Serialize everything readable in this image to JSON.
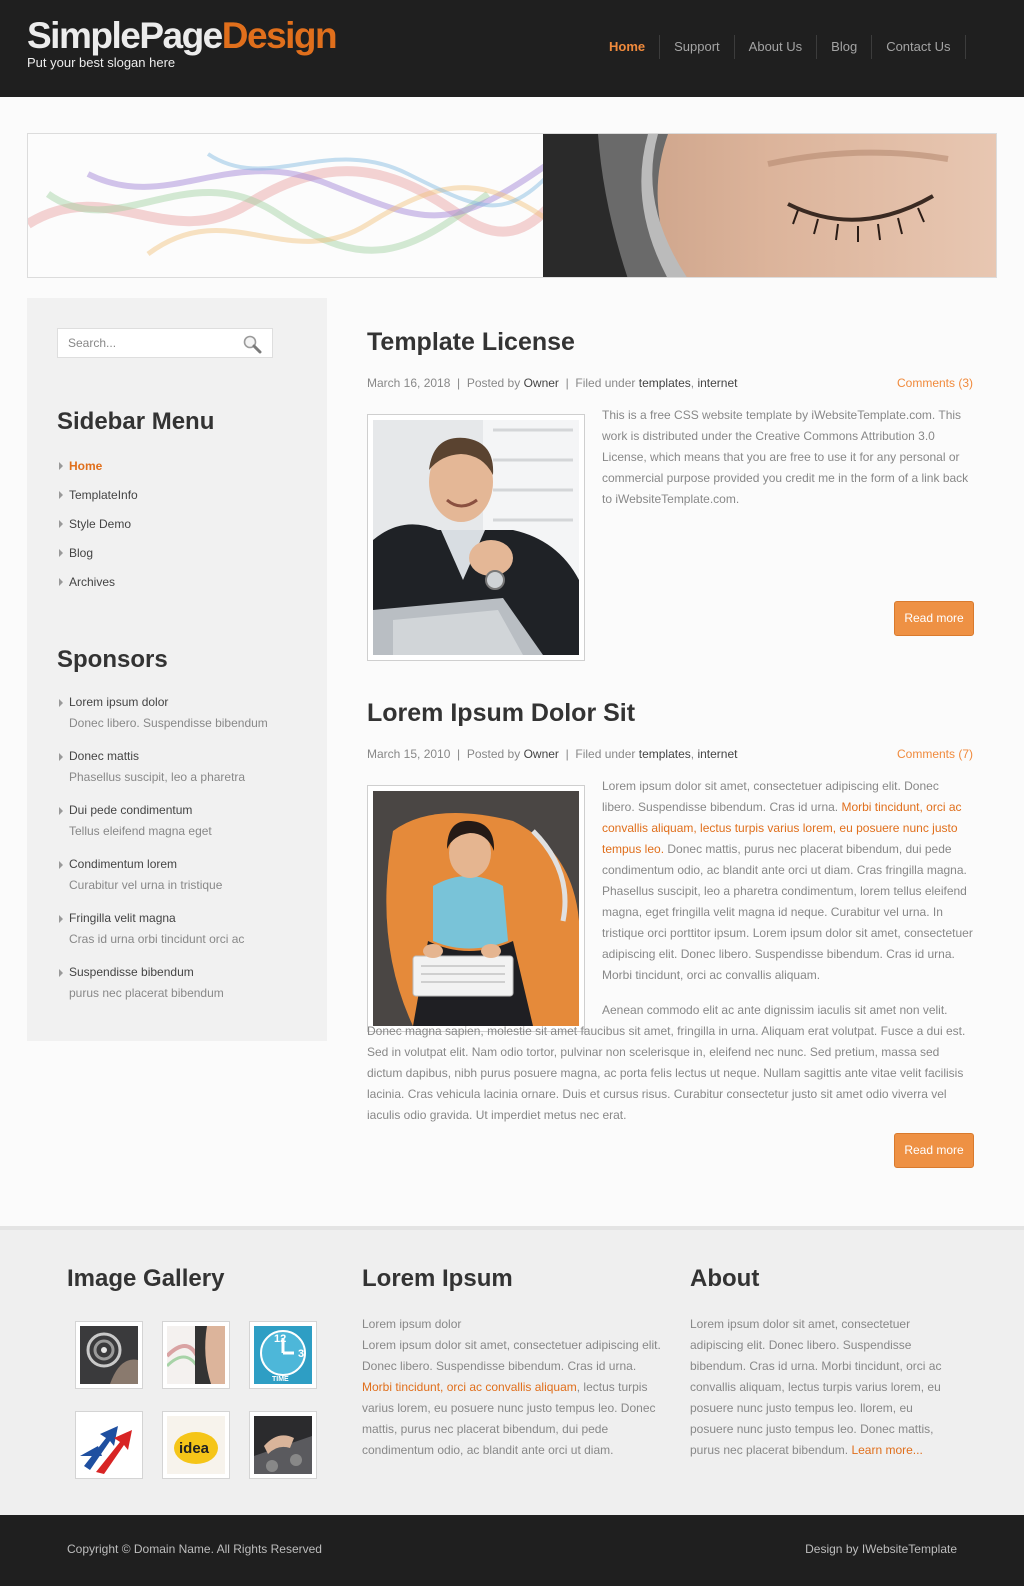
{
  "site": {
    "logo_part1": "SimplePage",
    "logo_part2": "Design",
    "slogan": "Put your best slogan here"
  },
  "nav": [
    "Home",
    "Support",
    "About Us",
    "Blog",
    "Contact Us"
  ],
  "search": {
    "placeholder": "Search..."
  },
  "sidebar": {
    "menu_title": "Sidebar Menu",
    "menu": [
      "Home",
      "TemplateInfo",
      "Style Demo",
      "Blog",
      "Archives"
    ],
    "sponsors_title": "Sponsors",
    "sponsors": [
      {
        "title": "Lorem ipsum dolor",
        "desc": "Donec libero. Suspendisse bibendum"
      },
      {
        "title": "Donec mattis",
        "desc": "Phasellus suscipit, leo a pharetra"
      },
      {
        "title": "Dui pede condimentum",
        "desc": "Tellus eleifend magna eget"
      },
      {
        "title": "Condimentum lorem",
        "desc": "Curabitur vel urna in tristique"
      },
      {
        "title": "Fringilla velit magna",
        "desc": "Cras id urna orbi tincidunt orci ac"
      },
      {
        "title": "Suspendisse bibendum",
        "desc": "purus nec placerat bibendum"
      }
    ]
  },
  "posts": [
    {
      "title": "Template License",
      "date": "March 16, 2018",
      "posted_by_label": "Posted by",
      "author": "Owner",
      "filed_label": "Filed under",
      "tag1": "templates",
      "tag2": "internet",
      "comments": "Comments (3)",
      "text": "This is a free CSS website template by iWebsiteTemplate.com. This work is distributed under the Creative Commons Attribution 3.0 License, which means that you are free to use it for any personal or commercial purpose provided you credit me in the form of a link back to iWebsiteTemplate.com.",
      "read_more": "Read more"
    },
    {
      "title": "Lorem Ipsum Dolor Sit",
      "date": "March 15, 2010",
      "posted_by_label": "Posted by",
      "author": "Owner",
      "filed_label": "Filed under",
      "tag1": "templates",
      "tag2": "internet",
      "comments": "Comments (7)",
      "text_before": "Lorem ipsum dolor sit amet, consectetuer adipiscing elit. Donec libero. Suspendisse bibendum. Cras id urna. ",
      "text_link": "Morbi tincidunt, orci ac convallis aliquam, lectus turpis varius lorem, eu posuere nunc justo tempus leo.",
      "text_after": " Donec mattis, purus nec placerat bibendum, dui pede condimentum odio, ac blandit ante orci ut diam. Cras fringilla magna. Phasellus suscipit, leo a pharetra condimentum, lorem tellus eleifend magna, eget fringilla velit magna id neque. Curabitur vel urna. In tristique orci porttitor ipsum. Lorem ipsum dolor sit amet, consectetuer adipiscing elit. Donec libero. Suspendisse bibendum. Cras id urna. Morbi tincidunt, orci ac convallis aliquam.",
      "text2": "Aenean commodo elit ac ante dignissim iaculis sit amet non velit. Donec magna sapien, molestie sit amet faucibus sit amet, fringilla in urna. Aliquam erat volutpat. Fusce a dui est. Sed in volutpat elit. Nam odio tortor, pulvinar non scelerisque in, eleifend nec nunc. Sed pretium, massa sed dictum dapibus, nibh purus posuere magna, ac porta felis lectus ut neque. Nullam sagittis ante vitae velit facilisis lacinia. Cras vehicula lacinia ornare. Duis et cursus risus. Curabitur consectetur justo sit amet odio viverra vel iaculis odio gravida. Ut imperdiet metus nec erat.",
      "read_more": "Read more"
    }
  ],
  "footer": {
    "gallery_title": "Image Gallery",
    "gallery_idea_word": "idea",
    "gallery_clock_label": "TIME",
    "lorem_title": "Lorem Ipsum",
    "lorem_line1": "Lorem ipsum dolor",
    "lorem_text_before": "Lorem ipsum dolor sit amet, consectetuer adipiscing elit. Donec libero. Suspendisse bibendum. Cras id urna. ",
    "lorem_link": "Morbi tincidunt, orci ac convallis aliquam",
    "lorem_text_after": ", lectus turpis varius lorem, eu posuere nunc justo tempus leo. Donec mattis, purus nec placerat bibendum, dui pede condimentum odio, ac blandit ante orci ut diam.",
    "about_title": "About",
    "about_text": "Lorem ipsum dolor sit amet, consectetuer adipiscing elit. Donec libero. Suspendisse bibendum. Cras id urna. Morbi tincidunt, orci ac convallis aliquam, lectus turpis varius lorem, eu posuere nunc justo tempus leo. llorem, eu posuere nunc justo tempus leo. Donec mattis, purus nec placerat bibendum. ",
    "about_link": "Learn more...",
    "copyright_prefix": "Copyright ©",
    "domain_link": "Domain Name",
    "copyright_suffix": ". All Rights Reserved",
    "design_by": "Design by",
    "design_link": "IWebsiteTemplate"
  },
  "colors": {
    "accent": "#e06f1c",
    "nav_active": "#f08a3c",
    "button": "#ee9144",
    "header_bg": "#1f1f1f"
  }
}
